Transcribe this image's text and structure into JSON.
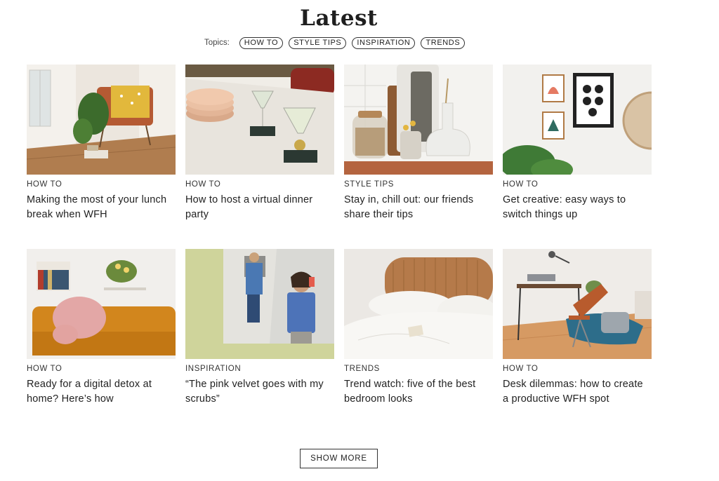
{
  "section_title": "Latest",
  "topics": {
    "label": "Topics:",
    "chips": [
      "HOW TO",
      "STYLE TIPS",
      "INSPIRATION",
      "TRENDS"
    ]
  },
  "articles": [
    {
      "category": "HOW TO",
      "headline": "Making the most of your lunch break when WFH"
    },
    {
      "category": "HOW TO",
      "headline": "How to host a virtual dinner party"
    },
    {
      "category": "STYLE TIPS",
      "headline": "Stay in, chill out: our friends share their tips"
    },
    {
      "category": "HOW TO",
      "headline": "Get creative: easy ways to switch things up"
    },
    {
      "category": "HOW TO",
      "headline": "Ready for a digital detox at home? Here’s how"
    },
    {
      "category": "INSPIRATION",
      "headline": "“The pink velvet goes with my scrubs”"
    },
    {
      "category": "TRENDS",
      "headline": "Trend watch: five of the best bedroom looks"
    },
    {
      "category": "HOW TO",
      "headline": "Desk dilemmas: how to create a productive WFH spot"
    }
  ],
  "show_more_label": "SHOW MORE"
}
